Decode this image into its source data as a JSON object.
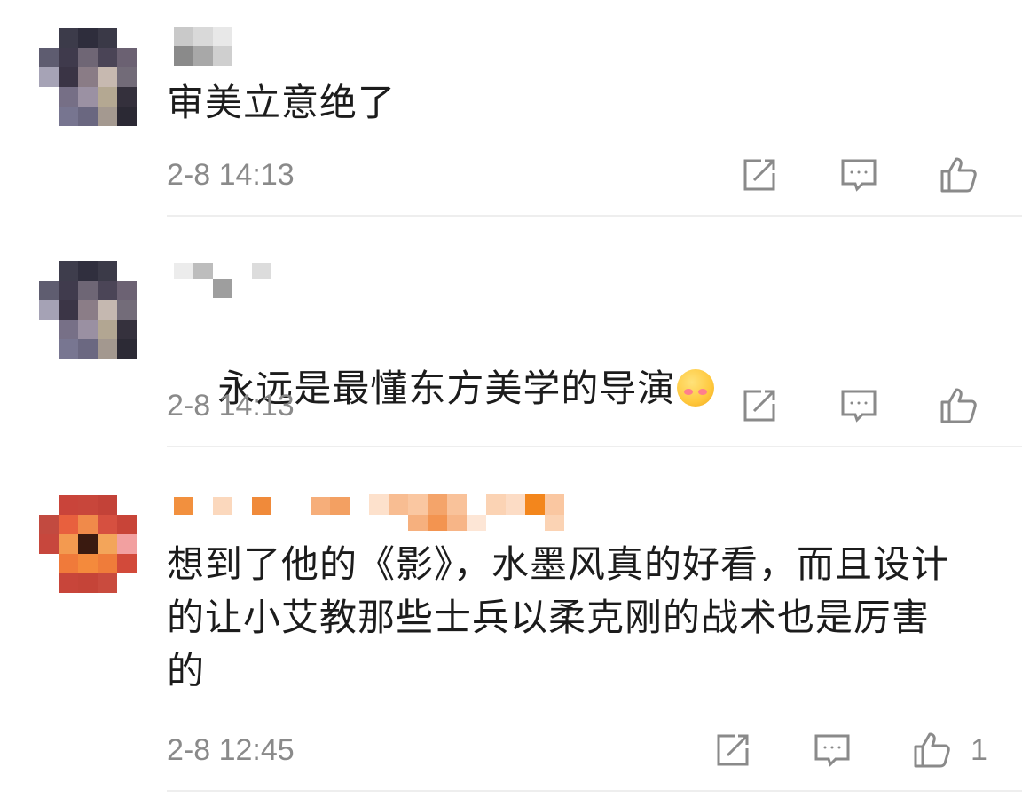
{
  "comments": [
    {
      "text": "审美立意绝了",
      "time": "2-8 14:13",
      "like_count": ""
    },
    {
      "text": "永远是最懂东方美学的导演",
      "time": "2-8 14:13",
      "like_count": ""
    },
    {
      "text": "想到了他的《影》，水墨风真的好看，而且设计的让小艾教那些士兵以柔克刚的战术也是厉害的",
      "time": "2-8 12:45",
      "like_count": "1"
    }
  ],
  "icons": {
    "share": "share-icon",
    "reply": "comment-icon",
    "like": "thumbs-up-icon"
  },
  "colors": {
    "text": "#1c1c1c",
    "meta": "#8a8a8a",
    "icon": "#8a8a8a",
    "divider": "#eeeeee"
  }
}
